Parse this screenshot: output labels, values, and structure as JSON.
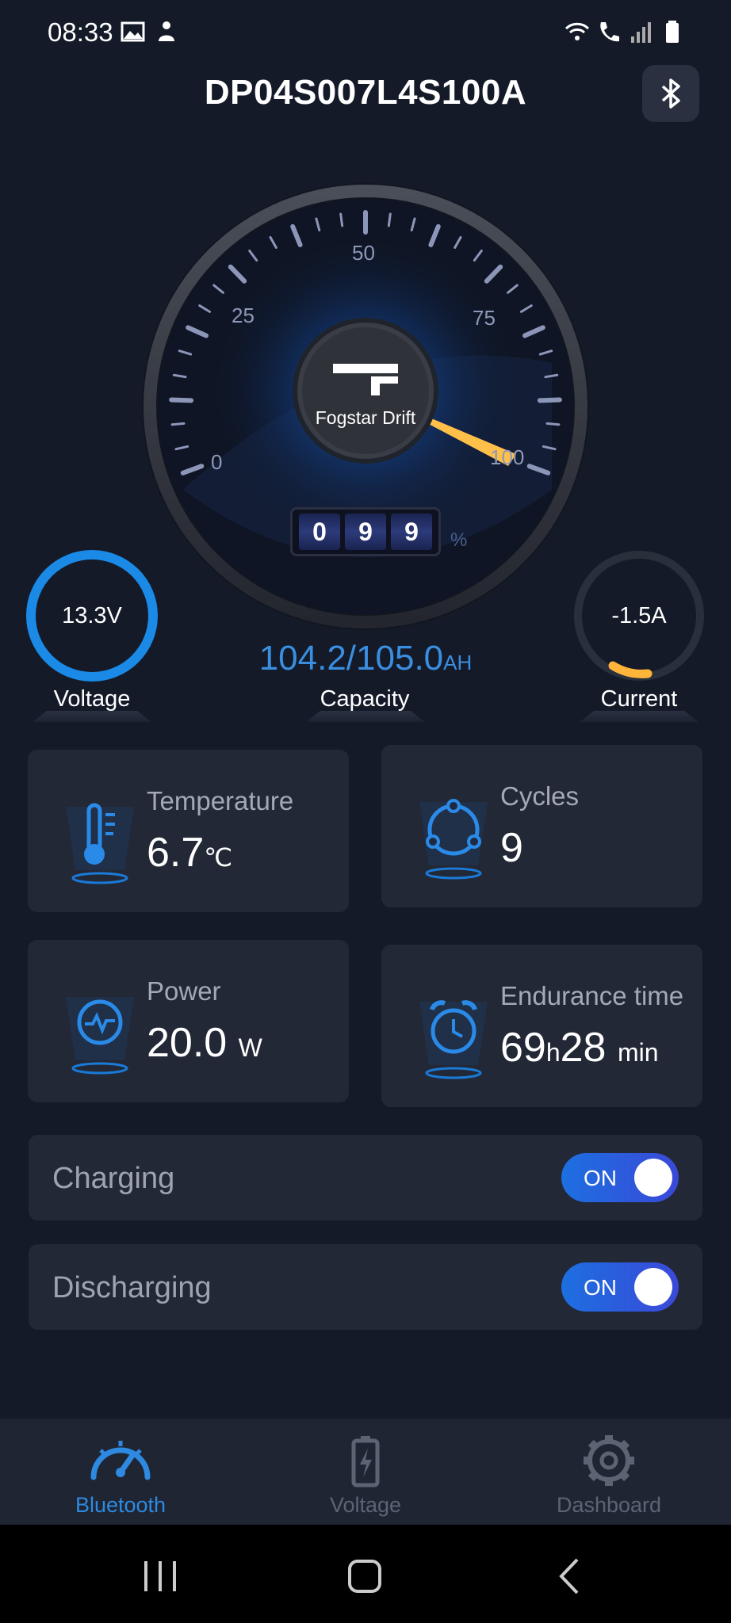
{
  "status_bar": {
    "time": "08:33",
    "left_icons": [
      "gallery-icon",
      "person-icon"
    ],
    "right_icons": [
      "wifi-icon",
      "call-icon",
      "signal-icon",
      "battery-icon"
    ]
  },
  "header": {
    "title": "DP04S007L4S100A",
    "bluetooth_icon": "bluetooth-icon"
  },
  "gauge": {
    "scale_labels": [
      "0",
      "25",
      "50",
      "75",
      "100"
    ],
    "brand": "Fogstar Drift",
    "level_percent": 99,
    "odometer_digits": [
      "0",
      "9",
      "9"
    ],
    "odometer_unit": "%"
  },
  "voltage": {
    "value": "13.3V",
    "label": "Voltage"
  },
  "capacity": {
    "value": "104.2/105.0",
    "unit": "AH",
    "label": "Capacity"
  },
  "current": {
    "value": "-1.5A",
    "label": "Current"
  },
  "cards": {
    "temperature": {
      "title": "Temperature",
      "value": "6.7",
      "unit": "℃"
    },
    "cycles": {
      "title": "Cycles",
      "value": "9"
    },
    "power": {
      "title": "Power",
      "value": "20.0",
      "unit": "W"
    },
    "endurance": {
      "title": "Endurance time",
      "hours": "69",
      "h_unit": "h",
      "minutes": "28",
      "min_unit": "min"
    }
  },
  "toggles": {
    "charging": {
      "label": "Charging",
      "state": "ON"
    },
    "discharging": {
      "label": "Discharging",
      "state": "ON"
    }
  },
  "bottom_nav": {
    "items": [
      {
        "label": "Bluetooth",
        "icon": "speedometer-icon",
        "active": true
      },
      {
        "label": "Voltage",
        "icon": "battery-icon",
        "active": false
      },
      {
        "label": "Dashboard",
        "icon": "gear-icon",
        "active": false
      }
    ]
  },
  "colors": {
    "background": "#141a28",
    "card": "#222836",
    "accent_blue": "#2d8ae0",
    "needle_yellow": "#ffc04a"
  }
}
